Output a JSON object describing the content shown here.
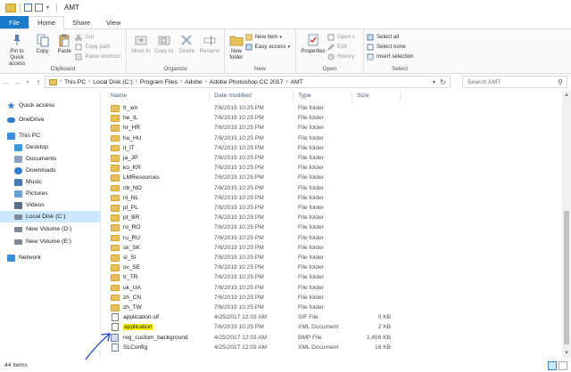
{
  "window": {
    "title": "AMT"
  },
  "tabs": [
    {
      "label": "File"
    },
    {
      "label": "Home"
    },
    {
      "label": "Share"
    },
    {
      "label": "View"
    }
  ],
  "ribbon": {
    "clipboard": {
      "group_label": "Clipboard",
      "pin": "Pin to Quick access",
      "copy": "Copy",
      "paste": "Paste",
      "cut": "Cut",
      "copy_path": "Copy path",
      "paste_shortcut": "Paste shortcut"
    },
    "organize": {
      "group_label": "Organize",
      "move_to": "Move to",
      "copy_to": "Copy to",
      "delete": "Delete",
      "rename": "Rename"
    },
    "new": {
      "group_label": "New",
      "new_folder": "New folder",
      "new_item": "New item",
      "easy_access": "Easy access"
    },
    "open": {
      "group_label": "Open",
      "properties": "Properties",
      "open": "Open",
      "edit": "Edit",
      "history": "History"
    },
    "select": {
      "group_label": "Select",
      "select_all": "Select all",
      "select_none": "Select none",
      "invert_selection": "Invert selection"
    }
  },
  "address": {
    "crumbs": [
      "This PC",
      "Local Disk (C:)",
      "Program Files",
      "Adobe",
      "Adobe Photoshop CC 2017",
      "AMT"
    ],
    "search_placeholder": "Search AMT"
  },
  "navpane": {
    "items": [
      {
        "label": "Quick access",
        "icon": "star-icon",
        "color": "#2b7cd3"
      },
      {
        "label": "OneDrive",
        "icon": "cloud-icon",
        "color": "#2b7cd3"
      },
      {
        "label": "This PC",
        "icon": "computer-icon",
        "color": "#3b8fd8"
      },
      {
        "label": "Desktop",
        "icon": "desktop-icon",
        "color": "#3c9be0"
      },
      {
        "label": "Documents",
        "icon": "documents-icon",
        "color": "#8aa4c0"
      },
      {
        "label": "Downloads",
        "icon": "download-icon",
        "color": "#2b7cd3"
      },
      {
        "label": "Music",
        "icon": "music-icon",
        "color": "#4a7bb8"
      },
      {
        "label": "Pictures",
        "icon": "pictures-icon",
        "color": "#6aa3d8"
      },
      {
        "label": "Videos",
        "icon": "videos-icon",
        "color": "#5b6e8a"
      },
      {
        "label": "Local Disk (C:)",
        "icon": "drive-icon",
        "color": "#7f8a96"
      },
      {
        "label": "New Volume (D:)",
        "icon": "drive-icon",
        "color": "#7f8a96"
      },
      {
        "label": "New Volume (E:)",
        "icon": "drive-icon",
        "color": "#7f8a96"
      },
      {
        "label": "Network",
        "icon": "network-icon",
        "color": "#3b8fd8"
      }
    ]
  },
  "columns": {
    "name": "Name",
    "date": "Date modified",
    "type": "Type",
    "size": "Size"
  },
  "files": [
    {
      "name": "fr_xm",
      "date": "7/6/2019 10:25 PM",
      "type": "File folder",
      "size": "",
      "kind": "folder"
    },
    {
      "name": "he_IL",
      "date": "7/6/2019 10:25 PM",
      "type": "File folder",
      "size": "",
      "kind": "folder"
    },
    {
      "name": "hr_HR",
      "date": "7/6/2019 10:25 PM",
      "type": "File folder",
      "size": "",
      "kind": "folder"
    },
    {
      "name": "hu_HU",
      "date": "7/6/2019 10:25 PM",
      "type": "File folder",
      "size": "",
      "kind": "folder"
    },
    {
      "name": "it_IT",
      "date": "7/6/2019 10:25 PM",
      "type": "File folder",
      "size": "",
      "kind": "folder"
    },
    {
      "name": "ja_JP",
      "date": "7/6/2019 10:25 PM",
      "type": "File folder",
      "size": "",
      "kind": "folder"
    },
    {
      "name": "ko_KR",
      "date": "7/6/2019 10:25 PM",
      "type": "File folder",
      "size": "",
      "kind": "folder"
    },
    {
      "name": "LMResources",
      "date": "7/6/2019 10:25 PM",
      "type": "File folder",
      "size": "",
      "kind": "folder"
    },
    {
      "name": "nb_NO",
      "date": "7/6/2019 10:25 PM",
      "type": "File folder",
      "size": "",
      "kind": "folder"
    },
    {
      "name": "nl_NL",
      "date": "7/6/2019 10:25 PM",
      "type": "File folder",
      "size": "",
      "kind": "folder"
    },
    {
      "name": "pl_PL",
      "date": "7/6/2019 10:25 PM",
      "type": "File folder",
      "size": "",
      "kind": "folder"
    },
    {
      "name": "pt_BR",
      "date": "7/6/2019 10:25 PM",
      "type": "File folder",
      "size": "",
      "kind": "folder"
    },
    {
      "name": "ro_RO",
      "date": "7/6/2019 10:25 PM",
      "type": "File folder",
      "size": "",
      "kind": "folder"
    },
    {
      "name": "ru_RU",
      "date": "7/6/2019 10:25 PM",
      "type": "File folder",
      "size": "",
      "kind": "folder"
    },
    {
      "name": "sk_SK",
      "date": "7/6/2019 10:25 PM",
      "type": "File folder",
      "size": "",
      "kind": "folder"
    },
    {
      "name": "sl_SI",
      "date": "7/6/2019 10:25 PM",
      "type": "File folder",
      "size": "",
      "kind": "folder"
    },
    {
      "name": "sv_SE",
      "date": "7/6/2019 10:25 PM",
      "type": "File folder",
      "size": "",
      "kind": "folder"
    },
    {
      "name": "tr_TR",
      "date": "7/6/2019 10:25 PM",
      "type": "File folder",
      "size": "",
      "kind": "folder"
    },
    {
      "name": "uk_UA",
      "date": "7/6/2019 10:25 PM",
      "type": "File folder",
      "size": "",
      "kind": "folder"
    },
    {
      "name": "zh_CN",
      "date": "7/6/2019 10:25 PM",
      "type": "File folder",
      "size": "",
      "kind": "folder"
    },
    {
      "name": "zh_TW",
      "date": "7/6/2019 10:25 PM",
      "type": "File folder",
      "size": "",
      "kind": "folder"
    },
    {
      "name": "application.sif",
      "date": "4/25/2017 12:03 AM",
      "type": "SIF File",
      "size": "0 KB",
      "kind": "doc"
    },
    {
      "name": "application",
      "date": "7/6/2019 10:25 PM",
      "type": "XML Document",
      "size": "2 KB",
      "kind": "xml",
      "highlight": true
    },
    {
      "name": "reg_custom_background",
      "date": "4/25/2017 12:03 AM",
      "type": "BMP File",
      "size": "1,456 KB",
      "kind": "bmp"
    },
    {
      "name": "SLConfig",
      "date": "4/25/2017 12:03 AM",
      "type": "XML Document",
      "size": "16 KB",
      "kind": "cfg"
    }
  ],
  "status": {
    "count": "44 items"
  },
  "colors": {
    "file_tab": "#1979ca",
    "selected_nav": "#cce8ff",
    "highlight": "#fff100",
    "annotation": "#1a3fd6"
  }
}
